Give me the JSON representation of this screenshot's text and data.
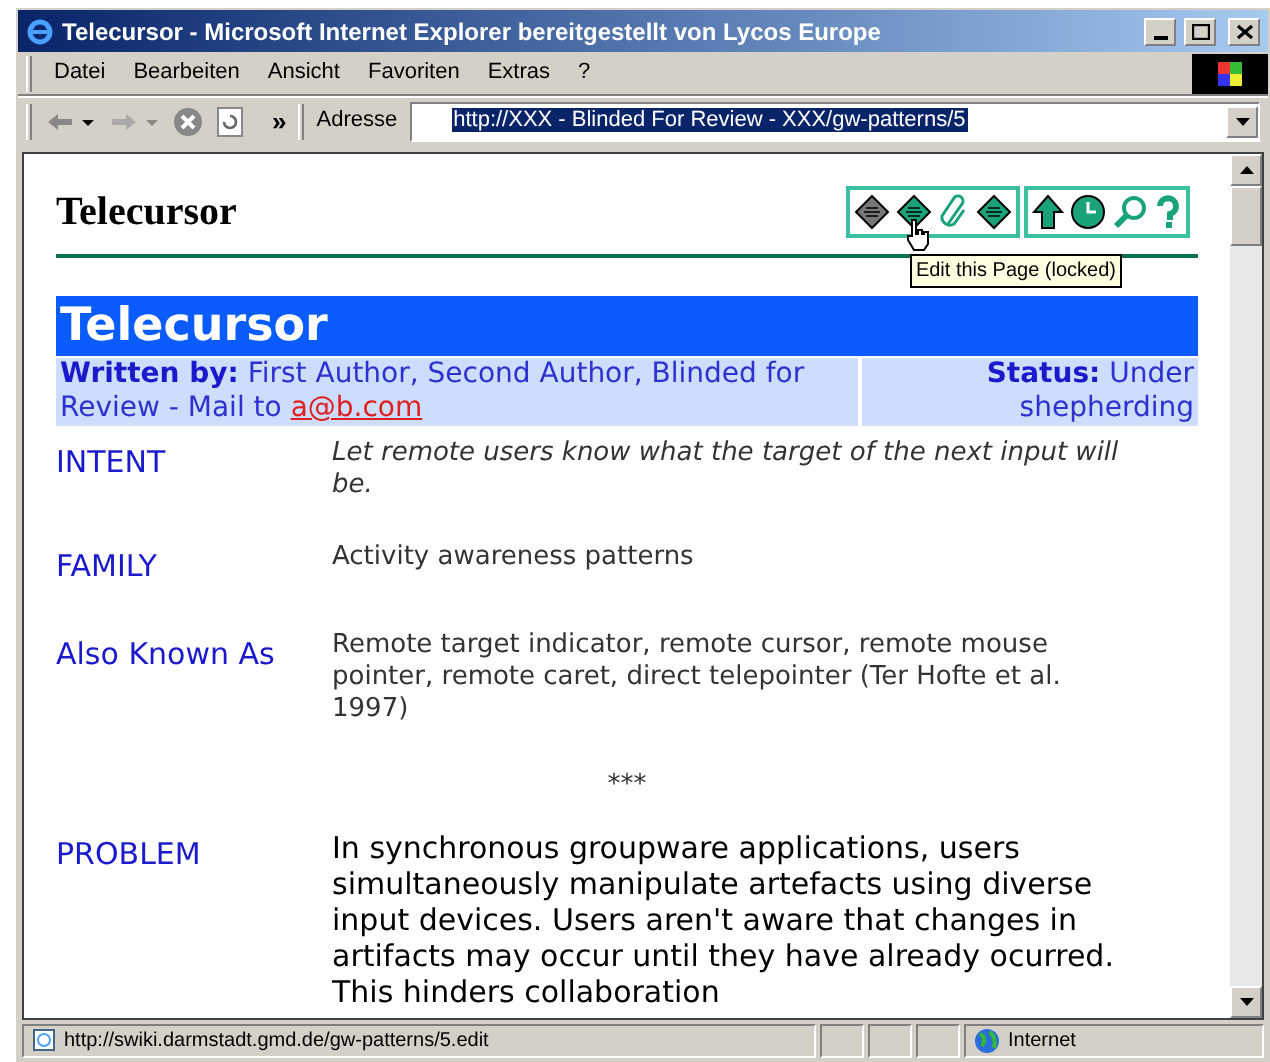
{
  "window": {
    "title": "Telecursor - Microsoft Internet Explorer bereitgestellt von Lycos Europe"
  },
  "menu": [
    "Datei",
    "Bearbeiten",
    "Ansicht",
    "Favoriten",
    "Extras",
    "?"
  ],
  "address": {
    "label": "Adresse",
    "value": "http://XXX - Blinded For Review - XXX/gw-patterns/5"
  },
  "toolbar_more": "»",
  "page": {
    "heading": "Telecursor",
    "tooltip": "Edit this Page (locked)",
    "title": "Telecursor",
    "written_by_label": "Written by:",
    "written_by": "First Author, Second Author, Blinded for Review - Mail to",
    "email": "a@b.com",
    "status_label": "Status:",
    "status": "Under shepherding",
    "sections": [
      {
        "label": "INTENT",
        "kind": "italic",
        "text": "Let remote users know what the target of the next input will be."
      },
      {
        "label": "FAMILY",
        "kind": "plain",
        "text": "Activity awareness patterns"
      },
      {
        "label": "Also Known As",
        "kind": "plain",
        "text": "Remote target indicator, remote cursor, remote mouse pointer, remote caret, direct telepointer (Ter Hofte et al. 1997)"
      },
      {
        "kind": "separator",
        "text": "***"
      },
      {
        "label": "PROBLEM",
        "kind": "large",
        "text": "In synchronous groupware applications, users simultaneously manipulate artefacts using diverse input devices. Users aren't aware that changes in artifacts may occur until they have already ocurred. This hinders collaboration"
      }
    ]
  },
  "status_bar": {
    "url": "http://swiki.darmstadt.gmd.de/gw-patterns/5.edit",
    "zone": "Internet"
  }
}
